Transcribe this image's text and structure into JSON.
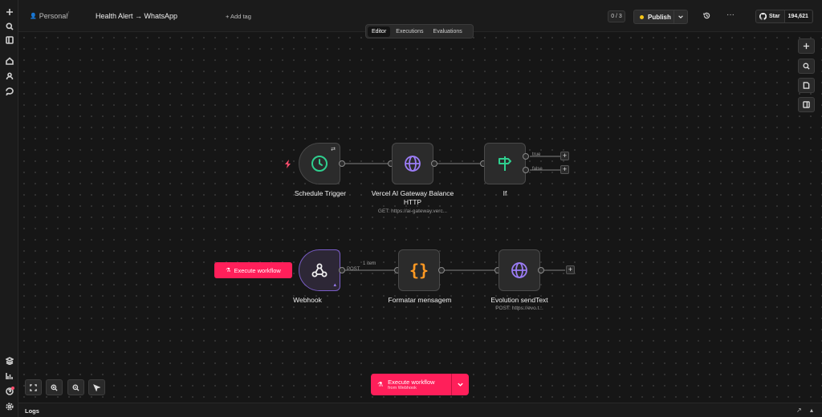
{
  "sidebar": {
    "top_icons": [
      "plus-icon",
      "search-icon",
      "panel-icon"
    ],
    "mid_icons": [
      "home-icon",
      "user-icon",
      "chat-icon"
    ],
    "bottom_icons": [
      "templates-icon",
      "insights-icon",
      "help-icon",
      "settings-icon"
    ]
  },
  "header": {
    "project": "Personal",
    "separator": "/",
    "title": "Health Alert → WhatsApp",
    "add_tag": "+ Add tag",
    "counter": "0 / 3",
    "publish": "Publish",
    "github_star": "Star",
    "github_count": "194,621"
  },
  "tabs": [
    {
      "label": "Editor",
      "active": true
    },
    {
      "label": "Executions",
      "active": false
    },
    {
      "label": "Evaluations",
      "active": false
    }
  ],
  "nodes": {
    "schedule": {
      "label": "Schedule Trigger",
      "icon": "clock-icon"
    },
    "vercel": {
      "label": "Vercel AI Gateway Balance HTTP",
      "sub": "GET: https://ai-gateway.verc...",
      "icon": "globe-icon"
    },
    "if": {
      "label": "If",
      "icon": "signpost-icon",
      "true_label": "true",
      "false_label": "false"
    },
    "webhook": {
      "label": "Webhook",
      "icon": "webhook-icon",
      "edge_label": "POST",
      "items_label": "1 item"
    },
    "formatar": {
      "label": "Formatar mensagem",
      "icon": "braces-icon"
    },
    "evolution": {
      "label": "Evolution sendText",
      "sub": "POST: https://evo.t...",
      "icon": "globe-icon"
    }
  },
  "execute_node_button": "Execute workflow",
  "execute_main": {
    "label": "Execute workflow",
    "sub": "from Webhook"
  },
  "logs": {
    "label": "Logs"
  },
  "colors": {
    "accent": "#ff1f5a",
    "publish_dot": "#f5c518",
    "webhook_border": "#7a5dc7"
  }
}
